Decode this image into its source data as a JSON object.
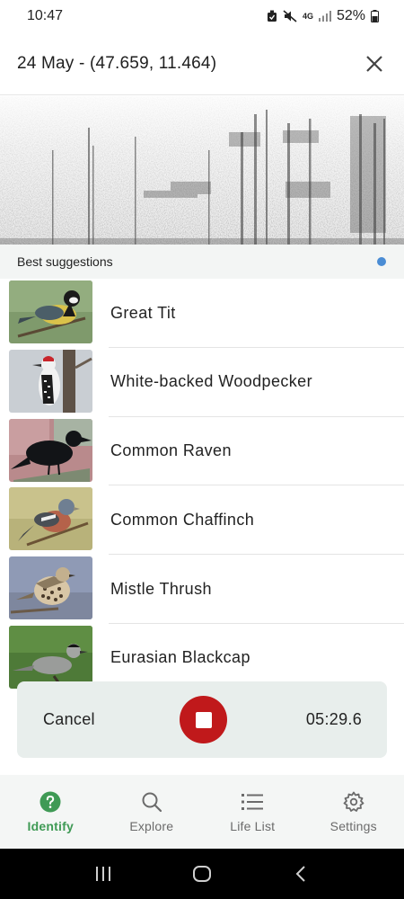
{
  "status_bar": {
    "time": "10:47",
    "network": "4G",
    "battery": "52%"
  },
  "header": {
    "title": "24 May - (47.659, 11.464)",
    "close_icon": "close-icon"
  },
  "suggestions": {
    "heading": "Best suggestions",
    "indicator_color": "#4a8cd4",
    "items": [
      {
        "name": "Great Tit",
        "thumb": "great-tit-photo"
      },
      {
        "name": "White-backed Woodpecker",
        "thumb": "woodpecker-photo"
      },
      {
        "name": "Common Raven",
        "thumb": "raven-photo"
      },
      {
        "name": "Common Chaffinch",
        "thumb": "chaffinch-photo"
      },
      {
        "name": "Mistle Thrush",
        "thumb": "thrush-photo"
      },
      {
        "name": "Eurasian Blackcap",
        "thumb": "blackcap-photo"
      }
    ]
  },
  "recording": {
    "cancel_label": "Cancel",
    "timer": "05:29.6",
    "stop_color": "#c0191b"
  },
  "bottom_nav": {
    "items": [
      {
        "label": "Identify",
        "icon": "question-circle-icon",
        "active": true
      },
      {
        "label": "Explore",
        "icon": "search-icon",
        "active": false
      },
      {
        "label": "Life List",
        "icon": "list-icon",
        "active": false
      },
      {
        "label": "Settings",
        "icon": "gear-icon",
        "active": false
      }
    ]
  },
  "colors": {
    "accent": "#3f9a55",
    "panel": "#e8eeec"
  }
}
